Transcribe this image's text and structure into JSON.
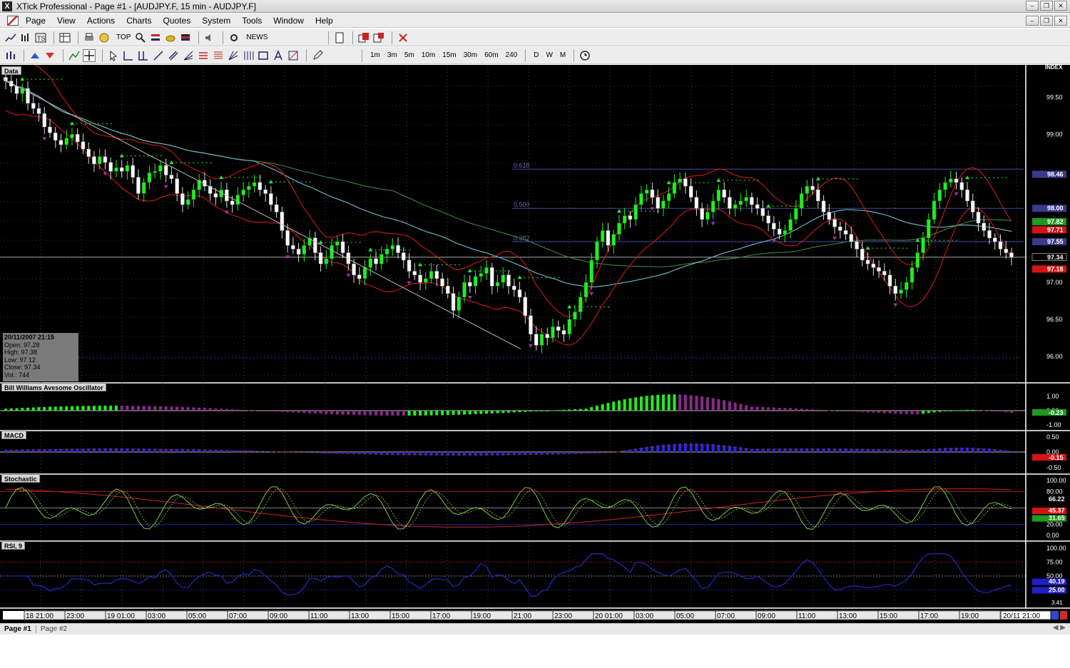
{
  "window": {
    "title": "XTick Professional - Page #1 - [AUDJPY.F, 15 min - AUDJPY.F]",
    "logo": "X"
  },
  "menu": [
    "Page",
    "View",
    "Actions",
    "Charts",
    "Quotes",
    "System",
    "Tools",
    "Window",
    "Help"
  ],
  "toolbar1": {
    "top_label": "TOP",
    "news_label": "NEWS"
  },
  "toolbar2": {
    "timeframes": [
      "1m",
      "3m",
      "5m",
      "10m",
      "15m",
      "30m",
      "60m",
      "240"
    ],
    "periods": [
      "D",
      "W",
      "M"
    ]
  },
  "panels": {
    "data": "Data",
    "ao": "Bill Williams Avesome Oscillator",
    "macd": "MACD",
    "stoch": "Stochastic",
    "rsi": "RSI, 9"
  },
  "info": {
    "date": "20/11/2007 21:15",
    "open": "Open: 97.28",
    "high": "High: 97.38",
    "low": "Low: 97.12",
    "close": "Close: 97.34",
    "vol": "Vol.: 744"
  },
  "price_axis": {
    "header": "INDEX",
    "ticks": [
      "99.50",
      "99.00",
      "97.00",
      "96.50",
      "96.00"
    ]
  },
  "price_tags": [
    {
      "text": "98.46",
      "bg": "#3b3b8a"
    },
    {
      "text": "98.00",
      "bg": "#3b3b8a"
    },
    {
      "text": "97.82",
      "bg": "#1f9b1f"
    },
    {
      "text": "97.71",
      "bg": "#d41414"
    },
    {
      "text": "97.55",
      "bg": "#3b3b8a"
    },
    {
      "text": "97.34",
      "bg": "#000000"
    },
    {
      "text": "97.18",
      "bg": "#d41414"
    }
  ],
  "fib": [
    {
      "label": "0.618"
    },
    {
      "label": "0.500"
    },
    {
      "label": "0.382"
    }
  ],
  "ao_axis": {
    "ticks": [
      "1.00",
      "0.00",
      "-1.00"
    ],
    "tag": "-0.23"
  },
  "macd_axis": {
    "ticks": [
      "0.50",
      "0.00",
      "-0.50"
    ],
    "tag": "-0.15"
  },
  "stoch_axis": {
    "ticks": [
      "100.00",
      "80.00",
      "20.00",
      "0.00"
    ],
    "tags": [
      {
        "text": "66.22",
        "bg": "#000000"
      },
      {
        "text": "45.37",
        "bg": "#d41414"
      },
      {
        "text": "31.65",
        "bg": "#1f9b1f"
      }
    ]
  },
  "rsi_axis": {
    "ticks": [
      "100.00",
      "75.00",
      "50.00"
    ],
    "tags": [
      {
        "text": "40.19",
        "bg": "#2020c8"
      },
      {
        "text": "25.00",
        "bg": "#2020c8"
      }
    ],
    "bottom": "3.41"
  },
  "time_axis": [
    "18 21:00",
    "23:00",
    "19 01:00",
    "03:00",
    "05:00",
    "07:00",
    "09:00",
    "11:00",
    "13:00",
    "15:00",
    "17:00",
    "19:00",
    "21:00",
    "23:00",
    "20 01:00",
    "03:00",
    "05:00",
    "07:00",
    "09:00",
    "11:00",
    "13:00",
    "15:00",
    "17:00",
    "19:00"
  ],
  "time_last": "20/11 21:00",
  "tabs": [
    "Page #1",
    "Page #2"
  ],
  "colors": {
    "bull": "#22ee22",
    "bear": "#8a2a8a",
    "band": "#cc1a1a",
    "ma1": "#6ab0c0",
    "ma2": "#3a7a3a",
    "macd": "#2828e0",
    "rsi": "#2828c8"
  },
  "chart_data": {
    "type": "candlestick",
    "symbol": "AUDJPY.F",
    "interval": "15 min",
    "ylim": [
      95.7,
      99.9
    ],
    "closes": [
      99.72,
      99.65,
      99.55,
      99.62,
      99.42,
      99.35,
      99.28,
      99.1,
      99.02,
      98.92,
      98.86,
      98.95,
      99.0,
      98.9,
      98.8,
      98.7,
      98.6,
      98.7,
      98.62,
      98.5,
      98.55,
      98.5,
      98.58,
      98.42,
      98.2,
      98.35,
      98.48,
      98.5,
      98.58,
      98.45,
      98.4,
      98.2,
      98.05,
      98.12,
      98.25,
      98.38,
      98.3,
      98.2,
      98.15,
      98.25,
      98.1,
      98.05,
      98.18,
      98.25,
      98.3,
      98.35,
      98.25,
      98.2,
      98.05,
      97.95,
      97.7,
      97.5,
      97.45,
      97.38,
      97.5,
      97.6,
      97.4,
      97.25,
      97.32,
      97.5,
      97.55,
      97.4,
      97.25,
      97.1,
      97.05,
      97.2,
      97.32,
      97.25,
      97.38,
      97.45,
      97.5,
      97.4,
      97.3,
      97.15,
      97.1,
      97.0,
      97.05,
      97.15,
      97.05,
      96.95,
      96.85,
      96.62,
      96.8,
      97.0,
      96.95,
      97.08,
      97.12,
      97.2,
      96.95,
      97.0,
      97.1,
      96.95,
      96.9,
      96.8,
      96.55,
      96.3,
      96.15,
      96.3,
      96.25,
      96.4,
      96.35,
      96.3,
      96.5,
      96.6,
      96.8,
      97.0,
      97.3,
      97.55,
      97.7,
      97.5,
      97.65,
      97.8,
      97.9,
      97.85,
      98.05,
      98.2,
      98.25,
      98.15,
      98.0,
      98.1,
      98.2,
      98.35,
      98.4,
      98.3,
      98.15,
      98.0,
      97.85,
      97.95,
      98.1,
      98.25,
      98.15,
      98.0,
      98.05,
      98.1,
      98.15,
      98.05,
      98.0,
      97.9,
      97.8,
      97.72,
      97.65,
      97.7,
      97.85,
      98.0,
      98.2,
      98.3,
      98.25,
      98.1,
      97.95,
      97.85,
      97.75,
      97.7,
      97.65,
      97.55,
      97.45,
      97.3,
      97.25,
      97.2,
      97.15,
      97.1,
      96.95,
      96.85,
      96.9,
      97.0,
      97.2,
      97.4,
      97.6,
      97.85,
      98.1,
      98.25,
      98.35,
      98.4,
      98.35,
      98.25,
      98.1,
      97.95,
      97.8,
      97.7,
      97.6,
      97.55,
      97.45,
      97.4,
      97.34
    ]
  }
}
